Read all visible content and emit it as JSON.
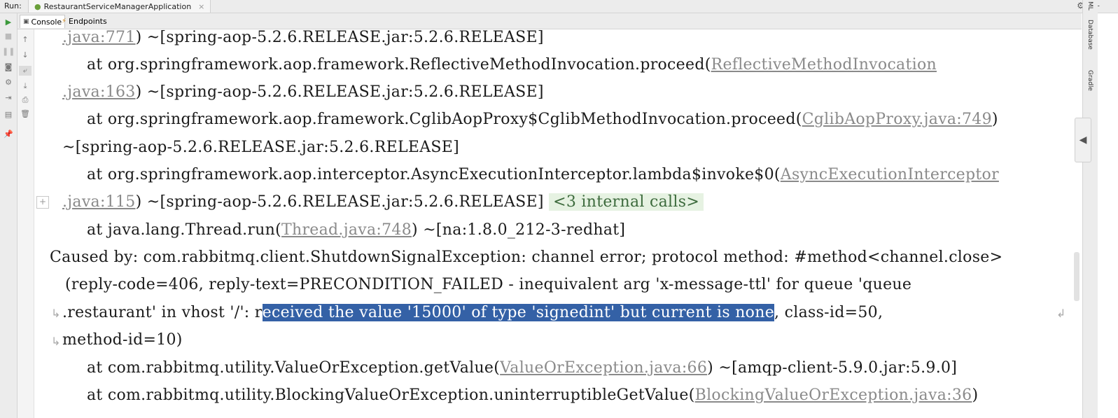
{
  "runbar": {
    "label": "Run:",
    "tab_title": "RestaurantServiceManagerApplication",
    "tab_close": "×"
  },
  "subtabs": {
    "console": "Console",
    "endpoints": "Endpoints"
  },
  "right_strip": {
    "item1": "ML",
    "item2": "Database",
    "item3": "Gradle"
  },
  "fold_button": "+",
  "console": {
    "l1": {
      "link": ".java:771",
      "rest": ") ~[spring-aop-5.2.6.RELEASE.jar:5.2.6.RELEASE]"
    },
    "l2": {
      "text": "at org.springframework.aop.framework.ReflectiveMethodInvocation.proceed(",
      "link": "ReflectiveMethodInvocation"
    },
    "l3": {
      "link": ".java:163",
      "rest": ") ~[spring-aop-5.2.6.RELEASE.jar:5.2.6.RELEASE]"
    },
    "l4": {
      "text": "at org.springframework.aop.framework.CglibAopProxy$CglibMethodInvocation.proceed(",
      "link": "CglibAopProxy.java:749",
      "rest": ")"
    },
    "l5": {
      "text": "~[spring-aop-5.2.6.RELEASE.jar:5.2.6.RELEASE]"
    },
    "l6": {
      "text": "at org.springframework.aop.interceptor.AsyncExecutionInterceptor.lambda$invoke$0(",
      "link": "AsyncExecutionInterceptor"
    },
    "l7": {
      "link": ".java:115",
      "rest": ") ~[spring-aop-5.2.6.RELEASE.jar:5.2.6.RELEASE]",
      "internal": "<3 internal calls>"
    },
    "l8": {
      "text": "at java.lang.Thread.run(",
      "link": "Thread.java:748",
      "rest": ") ~[na:1.8.0_212-3-redhat]"
    },
    "l9": {
      "text": "Caused by: com.rabbitmq.client.ShutdownSignalException: channel error; protocol method: #method<channel.close>"
    },
    "l10": {
      "text": "(reply-code=406, reply-text=PRECONDITION_FAILED - inequivalent arg 'x-message-ttl' for queue 'queue"
    },
    "l11": {
      "pre": ".restaurant' in vhost '/': r",
      "selected": "eceived the value '15000' of type 'signedint' but current is none",
      "post": ", class-id=50,"
    },
    "l12": {
      "text": "method-id=10)"
    },
    "l13": {
      "text": "at com.rabbitmq.utility.ValueOrException.getValue(",
      "link": "ValueOrException.java:66",
      "rest": ") ~[amqp-client-5.9.0.jar:5.9.0]"
    },
    "l14": {
      "text": "at com.rabbitmq.utility.BlockingValueOrException.uninterruptibleGetValue(",
      "link": "BlockingValueOrException.java:36",
      "rest": ")"
    }
  }
}
